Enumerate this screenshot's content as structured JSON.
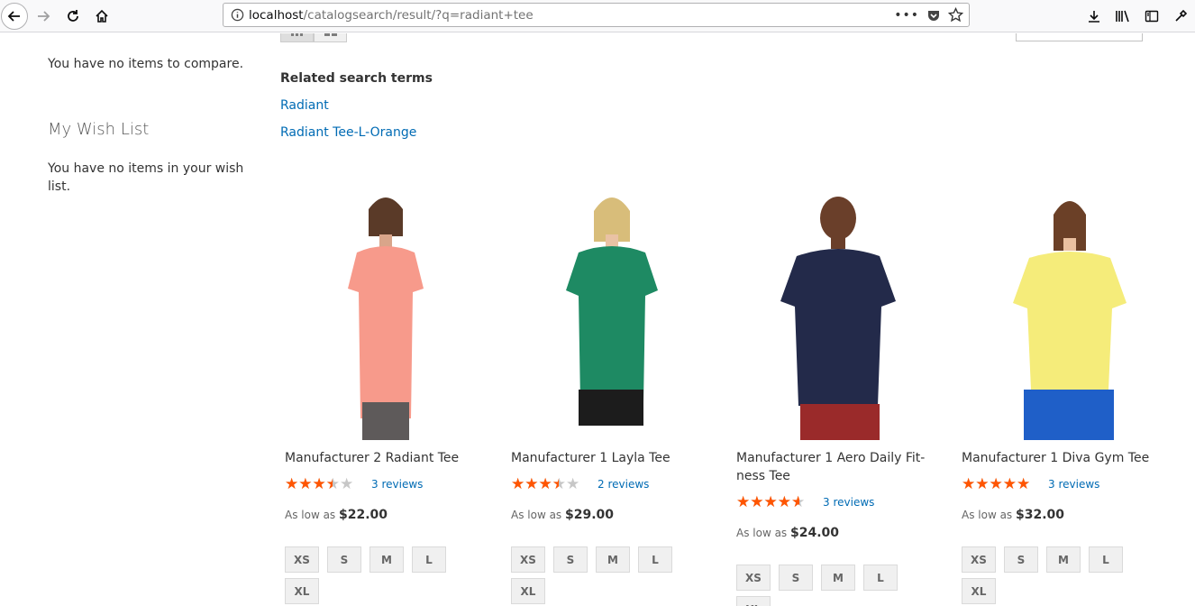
{
  "browser": {
    "url_host": "localhost",
    "url_path": "/catalogsearch/result/?q=radiant+tee"
  },
  "sidebar": {
    "compare_text": "You have no items to compare.",
    "wishlist_title": "My Wish List",
    "wishlist_text": "You have no items in your wish list."
  },
  "related": {
    "title": "Related search terms",
    "terms": [
      "Radiant",
      "Radiant Tee-L-Orange"
    ]
  },
  "products": [
    {
      "name": "Manufacturer 2 Radiant Tee",
      "rating_fraction": 0.6,
      "reviews": "3 reviews",
      "price_prefix": "As low as",
      "price": "$22.00",
      "sizes": [
        "XS",
        "S",
        "M",
        "L",
        "XL"
      ],
      "shirt_color": "#f79a8b",
      "bottom_color": "#5e5a5a"
    },
    {
      "name": "Manufacturer 1 Layla Tee",
      "rating_fraction": 0.6,
      "reviews": "2 reviews",
      "price_prefix": "As low as",
      "price": "$29.00",
      "sizes": [
        "XS",
        "S",
        "M",
        "L",
        "XL"
      ],
      "shirt_color": "#1e8a63",
      "bottom_color": "#1c1c1c"
    },
    {
      "name": "Manufacturer 1 Aero Daily Fit­ness Tee",
      "rating_fraction": 0.8,
      "reviews": "3 reviews",
      "price_prefix": "As low as",
      "price": "$24.00",
      "sizes": [
        "XS",
        "S",
        "M",
        "L",
        "XL"
      ],
      "shirt_color": "#232a4a",
      "bottom_color": "#9a2a2a"
    },
    {
      "name": "Manufacturer 1 Diva Gym Tee",
      "rating_fraction": 0.9,
      "reviews": "3 reviews",
      "price_prefix": "As low as",
      "price": "$32.00",
      "sizes": [
        "XS",
        "S",
        "M",
        "L",
        "XL"
      ],
      "shirt_color": "#f5ec7a",
      "bottom_color": "#1f5fc8"
    }
  ],
  "colors": {
    "link": "#006bb4",
    "star_on": "#ff5501",
    "star_off": "#c7c7c7"
  }
}
